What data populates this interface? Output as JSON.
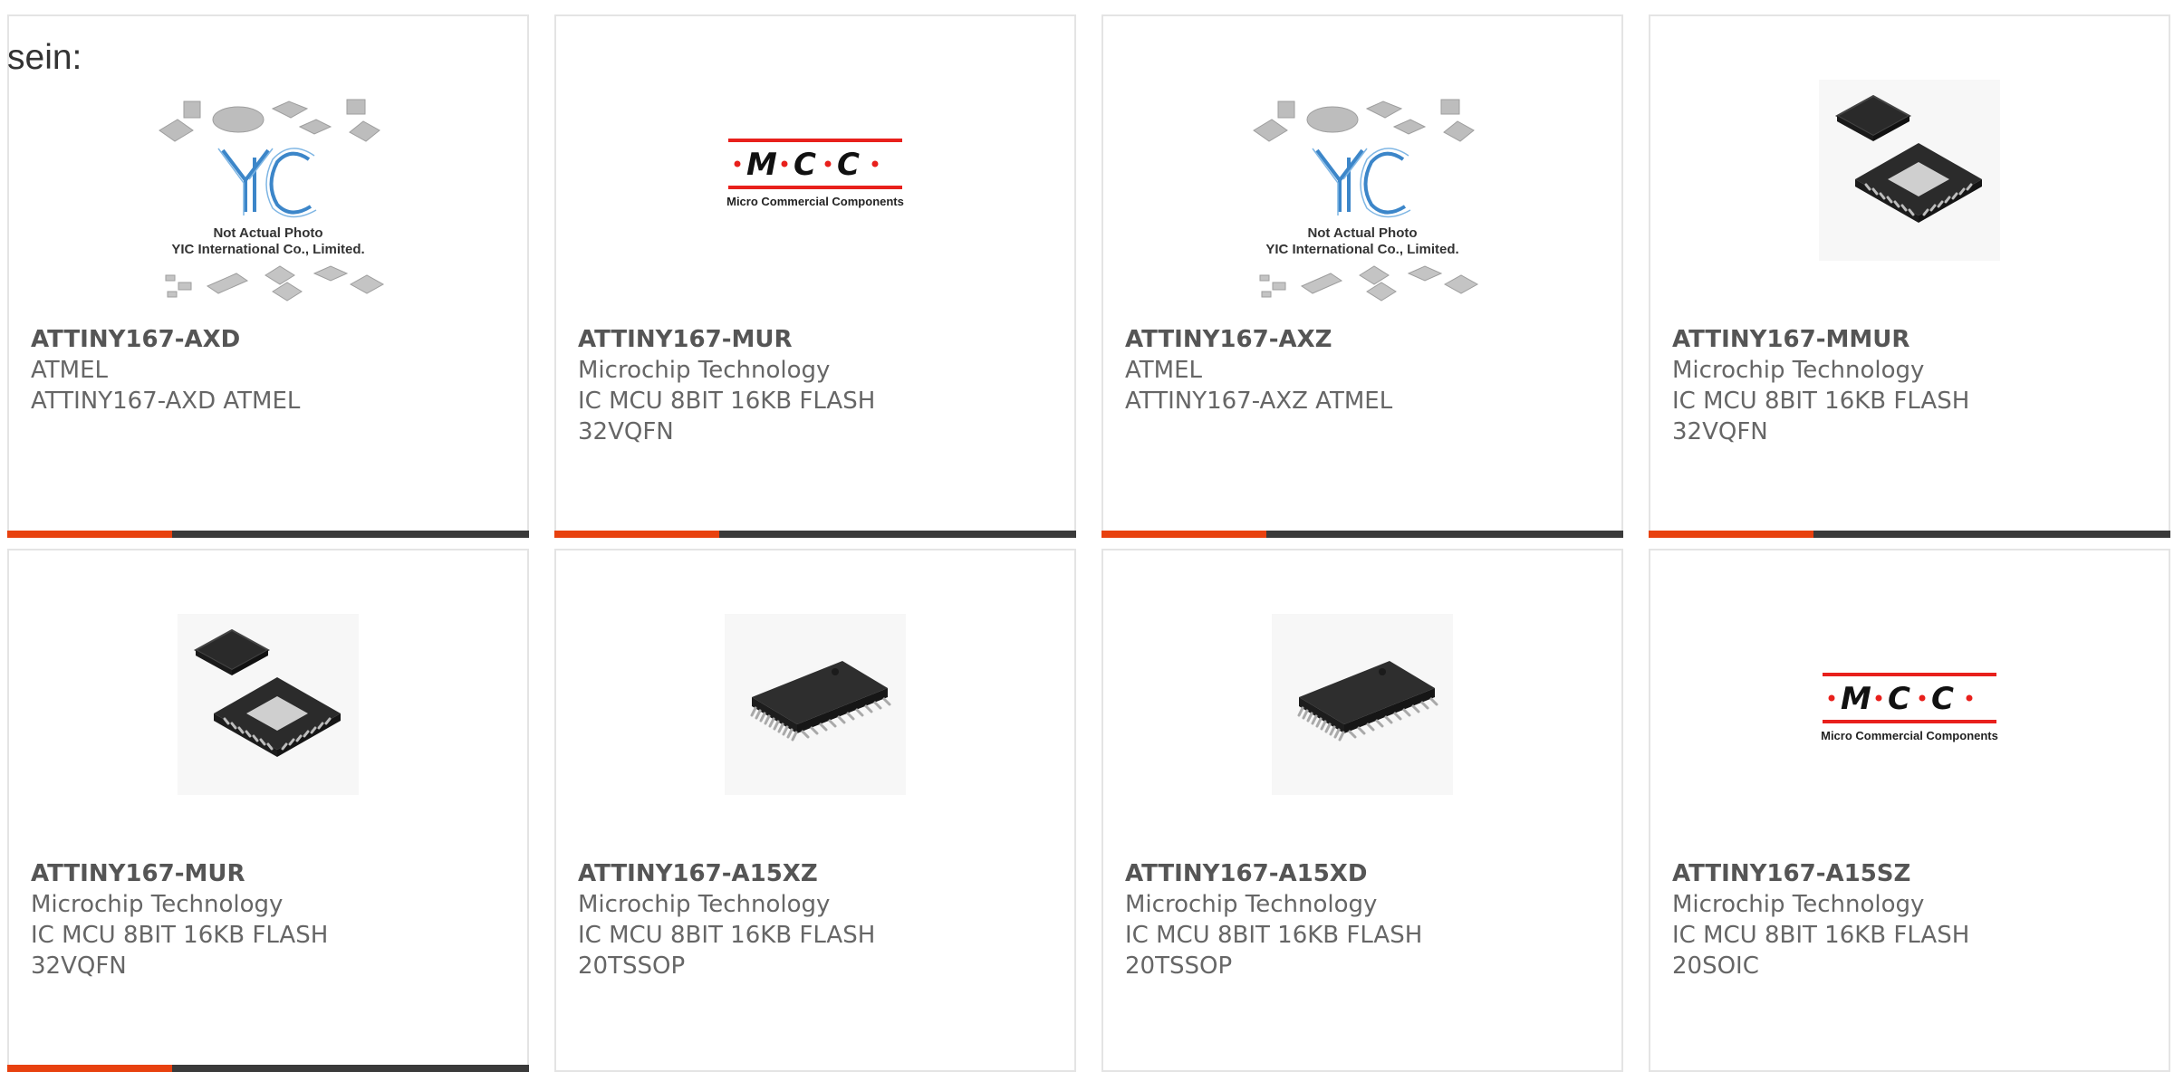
{
  "lead_text": "sein:",
  "colors": {
    "accent": "#e8410f",
    "bar": "#3a3a3a",
    "text": "#666666",
    "border": "#e4e4e4",
    "mcc_red": "#e8201c"
  },
  "images": {
    "yic": {
      "caption1": "Not Actual Photo",
      "caption2": "YIC International Co., Limited."
    },
    "mcc": {
      "tagline": "Micro Commercial Components"
    }
  },
  "products": [
    {
      "image": "yic-placeholder",
      "part_number": "ATTINY167-AXD",
      "manufacturer": "ATMEL",
      "desc1": "ATTINY167-AXD ATMEL",
      "desc2": ""
    },
    {
      "image": "mcc-logo",
      "part_number": "ATTINY167-MUR",
      "manufacturer": "Microchip Technology",
      "desc1": "IC MCU 8BIT 16KB FLASH",
      "desc2": "32VQFN"
    },
    {
      "image": "yic-placeholder",
      "part_number": "ATTINY167-AXZ",
      "manufacturer": "ATMEL",
      "desc1": "ATTINY167-AXZ ATMEL",
      "desc2": ""
    },
    {
      "image": "qfn-chip",
      "part_number": "ATTINY167-MMUR",
      "manufacturer": "Microchip Technology",
      "desc1": "IC MCU 8BIT 16KB FLASH",
      "desc2": "32VQFN"
    },
    {
      "image": "qfn-chip",
      "part_number": "ATTINY167-MUR",
      "manufacturer": "Microchip Technology",
      "desc1": "IC MCU 8BIT 16KB FLASH",
      "desc2": "32VQFN"
    },
    {
      "image": "tssop-chip",
      "part_number": "ATTINY167-A15XZ",
      "manufacturer": "Microchip Technology",
      "desc1": "IC MCU 8BIT 16KB FLASH",
      "desc2": "20TSSOP"
    },
    {
      "image": "tssop-chip",
      "part_number": "ATTINY167-A15XD",
      "manufacturer": "Microchip Technology",
      "desc1": "IC MCU 8BIT 16KB FLASH",
      "desc2": "20TSSOP"
    },
    {
      "image": "mcc-logo",
      "part_number": "ATTINY167-A15SZ",
      "manufacturer": "Microchip Technology",
      "desc1": "IC MCU 8BIT 16KB FLASH",
      "desc2": "20SOIC"
    }
  ]
}
